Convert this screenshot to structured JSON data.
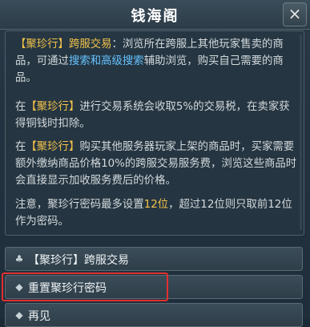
{
  "window": {
    "title": "钱海阁",
    "close_glyph": "×"
  },
  "paragraphs": {
    "p1": {
      "t1": "【聚珍行】跨服交易",
      "t2": "：浏览所在跨服上其他玩家售卖的商品，可通过",
      "t3": "搜索和高级搜索",
      "t4": "辅助浏览，购买自己需要的商品。"
    },
    "p2": {
      "t1": "在",
      "t2": "【聚珍行】",
      "t3": "进行交易系统会收取5%的交易税，在卖家获得铜钱时扣除。"
    },
    "p3": {
      "t1": "在",
      "t2": "【聚珍行】",
      "t3": "购买其他服务器玩家上架的商品时，买家需要额外缴纳商品价格10%的跨服交易服务费，浏览这些商品时会直接显示加收服务费后的价格。"
    },
    "p4": {
      "t1": "注意，聚珍行密码最多设置",
      "t2": "12位",
      "t3": "，超过12位则只取前12位作为密码。"
    }
  },
  "menu": {
    "items": [
      {
        "icon": "♣",
        "label": "【聚珍行】跨服交易"
      },
      {
        "icon": "◆",
        "label": "重置聚珍行密码"
      },
      {
        "icon": "◆",
        "label": "再见"
      }
    ]
  },
  "colors": {
    "highlight_yellow": "#f2c24a",
    "highlight_blue": "#66c2ff",
    "annotation_red": "#e23030"
  }
}
